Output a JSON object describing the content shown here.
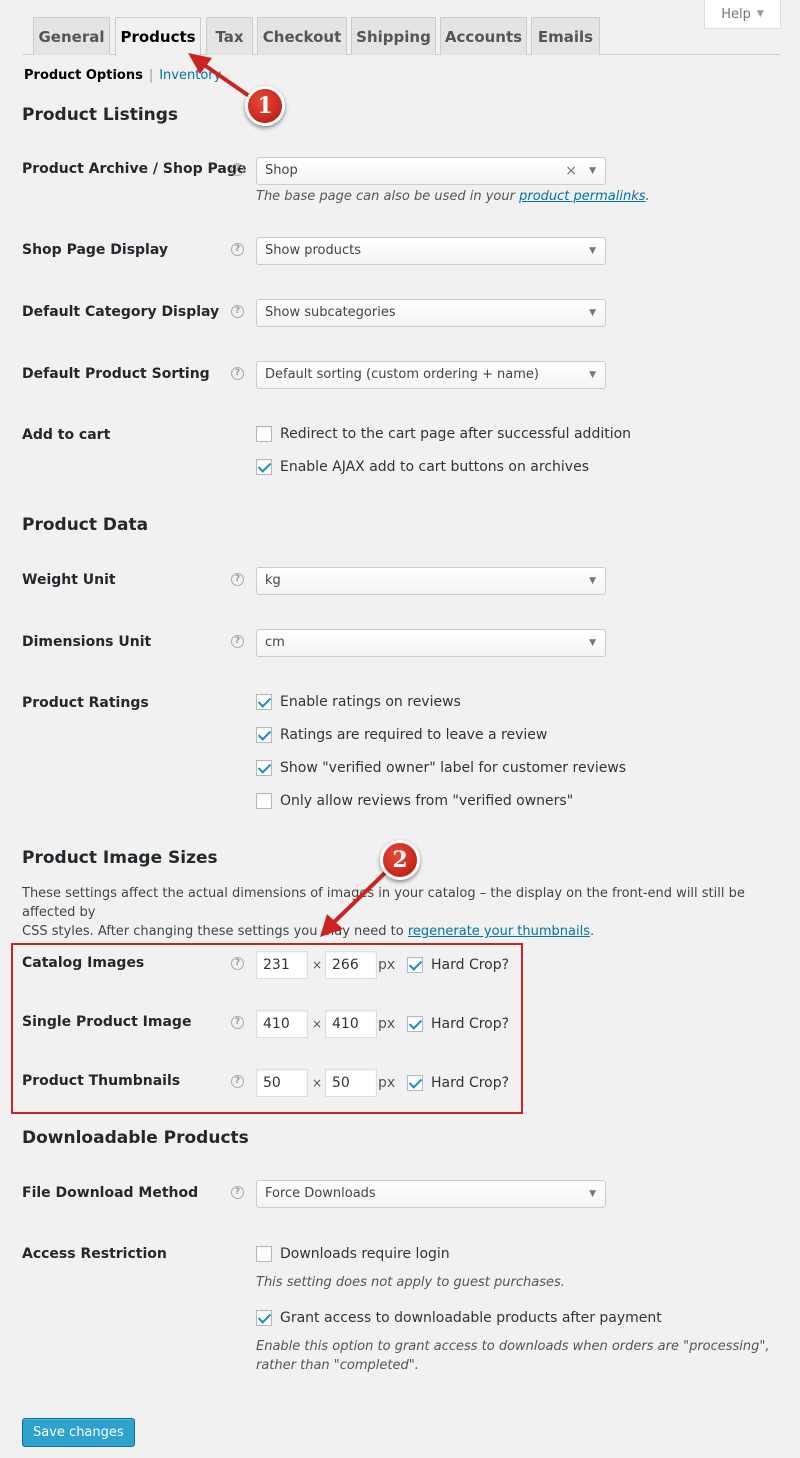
{
  "help": {
    "label": "Help",
    "caret": "▼"
  },
  "tabs": [
    "General",
    "Products",
    "Tax",
    "Checkout",
    "Shipping",
    "Accounts",
    "Emails"
  ],
  "subnav": {
    "current": "Product Options",
    "separator": "|",
    "link": "Inventory"
  },
  "sections": {
    "listings": "Product Listings",
    "data": "Product Data",
    "images": "Product Image Sizes",
    "downloads": "Downloadable Products"
  },
  "fields": {
    "shop_page": {
      "label": "Product Archive / Shop Page",
      "value": "Shop",
      "desc_prefix": "The base page can also be used in your ",
      "desc_link": "product permalinks",
      "desc_suffix": "."
    },
    "shop_display": {
      "label": "Shop Page Display",
      "value": "Show products"
    },
    "category_display": {
      "label": "Default Category Display",
      "value": "Show subcategories"
    },
    "sorting": {
      "label": "Default Product Sorting",
      "value": "Default sorting (custom ordering + name)"
    },
    "add_to_cart": {
      "label": "Add to cart",
      "options": [
        {
          "label": "Redirect to the cart page after successful addition",
          "checked": false
        },
        {
          "label": "Enable AJAX add to cart buttons on archives",
          "checked": true
        }
      ]
    },
    "weight_unit": {
      "label": "Weight Unit",
      "value": "kg"
    },
    "dimensions_unit": {
      "label": "Dimensions Unit",
      "value": "cm"
    },
    "ratings": {
      "label": "Product Ratings",
      "options": [
        {
          "label": "Enable ratings on reviews",
          "checked": true
        },
        {
          "label": "Ratings are required to leave a review",
          "checked": true
        },
        {
          "label": "Show \"verified owner\" label for customer reviews",
          "checked": true
        },
        {
          "label": "Only allow reviews from \"verified owners\"",
          "checked": false
        }
      ]
    },
    "image_intro": {
      "line1": "These settings affect the actual dimensions of images in your catalog – the display on the front-end will still be affected by",
      "line2_prefix": "CSS styles. After changing these settings you may need to ",
      "line2_link": "regenerate your thumbnails",
      "line2_suffix": "."
    },
    "image_sizes": [
      {
        "label": "Catalog Images",
        "width": "231",
        "height": "266",
        "unit": "px",
        "crop_label": "Hard Crop?",
        "crop": true
      },
      {
        "label": "Single Product Image",
        "width": "410",
        "height": "410",
        "unit": "px",
        "crop_label": "Hard Crop?",
        "crop": true
      },
      {
        "label": "Product Thumbnails",
        "width": "50",
        "height": "50",
        "unit": "px",
        "crop_label": "Hard Crop?",
        "crop": true
      }
    ],
    "times_symbol": "×",
    "download_method": {
      "label": "File Download Method",
      "value": "Force Downloads"
    },
    "access": {
      "label": "Access Restriction",
      "require_login": {
        "label": "Downloads require login",
        "checked": false
      },
      "require_login_desc": "This setting does not apply to guest purchases.",
      "grant_access": {
        "label": "Grant access to downloadable products after payment",
        "checked": true
      },
      "grant_desc_1": "Enable this option to grant access to downloads when orders are \"processing\",",
      "grant_desc_2": "rather than \"completed\"."
    }
  },
  "save_button": "Save changes",
  "annotations": {
    "badge1": "1",
    "badge2": "2",
    "color": "#cc2222"
  },
  "icons": {
    "help": "question-circle-icon",
    "clear": "×",
    "dropdown": "▼"
  }
}
